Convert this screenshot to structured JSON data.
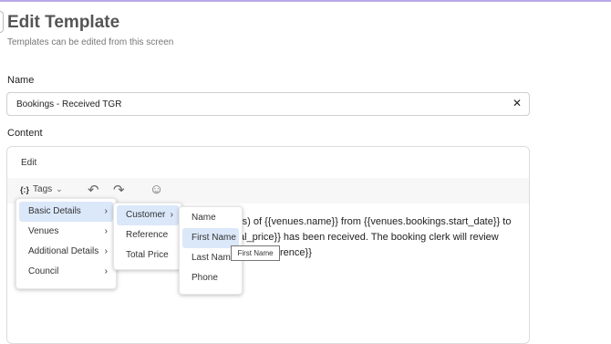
{
  "page": {
    "title": "Edit Template",
    "subtitle": "Templates can be edited from this screen"
  },
  "name_field": {
    "label": "Name",
    "value": "Bookings - Received TGR",
    "clear_icon": "close-icon",
    "clear_glyph": "✕"
  },
  "content": {
    "label": "Content",
    "tab_label": "Edit",
    "toolbar": {
      "tags_icon_text": "{:}",
      "tags_label": "Tags",
      "tags_chevron": "⌄",
      "undo_glyph": "↶",
      "redo_glyph": "↷",
      "emoji_glyph": "☺"
    },
    "body_lines": [
      "{s) of {{venues.name}} from {{venues.bookings.start_date}} to",
      "al_price}} has been received. The booking clerk will review",
      "rence}}"
    ]
  },
  "menus": {
    "level1": [
      {
        "label": "Basic Details",
        "arrow": "›"
      },
      {
        "label": "Venues",
        "arrow": "›"
      },
      {
        "label": "Additional Details",
        "arrow": "›"
      },
      {
        "label": "Council",
        "arrow": "›"
      }
    ],
    "level2": [
      {
        "label": "Customer",
        "arrow": "›"
      },
      {
        "label": "Reference"
      },
      {
        "label": "Total Price"
      }
    ],
    "level3": [
      {
        "label": "Name"
      },
      {
        "label": "First Name"
      },
      {
        "label": "Last Name"
      },
      {
        "label": "Phone"
      }
    ]
  },
  "tooltip": "First Name",
  "colors": {
    "accent_rule": "#b9a7e6",
    "menu_active": "#dbe8fa"
  }
}
